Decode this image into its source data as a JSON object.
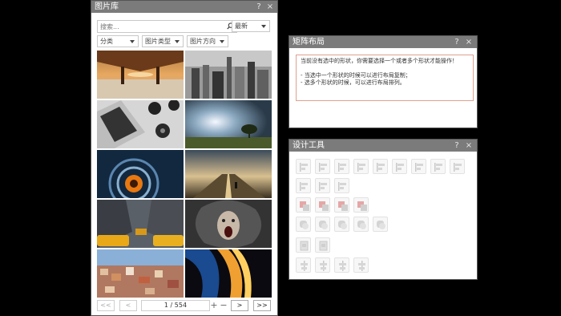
{
  "library": {
    "title": "图片库",
    "help": "?",
    "close": "×",
    "search_placeholder": "搜索...",
    "sort": "最新",
    "filters": [
      "分类",
      "图片类型",
      "图片方向"
    ],
    "thumbnails": [
      "pier-sunset",
      "city-skyline",
      "turntables-laptop",
      "lone-tree-sky",
      "abstract-tunnel",
      "road-runner",
      "taxi-street",
      "screaming-face",
      "colorful-town",
      "fire-streaks"
    ],
    "pager": {
      "first": "<<",
      "prev": "<",
      "page": "1 / 554",
      "zoom_in": "+",
      "zoom_out": "−",
      "next": ">",
      "last": ">>"
    }
  },
  "matrix": {
    "title": "矩阵布局",
    "help": "?",
    "close": "×",
    "message": [
      "当前没有选中的形状，你需要选择一个或者多个形状才能操作！",
      "",
      "- 当选中一个形状的时候可以进行布局复制；",
      "- 选多个形状的时候，可以进行布局排列。"
    ]
  },
  "design": {
    "title": "设计工具",
    "help": "?",
    "close": "×",
    "tools": [
      "align-left-icon",
      "align-center-h-icon",
      "align-right-icon",
      "align-top-icon",
      "align-middle-v-icon",
      "align-bottom-icon",
      "distribute-h-icon",
      "distribute-v-icon",
      "group-icon",
      "same-width-icon",
      "same-height-icon",
      "same-size-icon",
      "fill-icon-1",
      "fill-icon-2",
      "fill-icon-3",
      "fill-icon-4",
      "shape-icon-1",
      "shape-icon-2",
      "shape-icon-3",
      "shape-icon-4",
      "shape-icon-5",
      "copy-format-icon",
      "paste-format-icon",
      "center-h-icon",
      "center-v-icon",
      "middle-h-icon",
      "middle-v-icon"
    ]
  }
}
